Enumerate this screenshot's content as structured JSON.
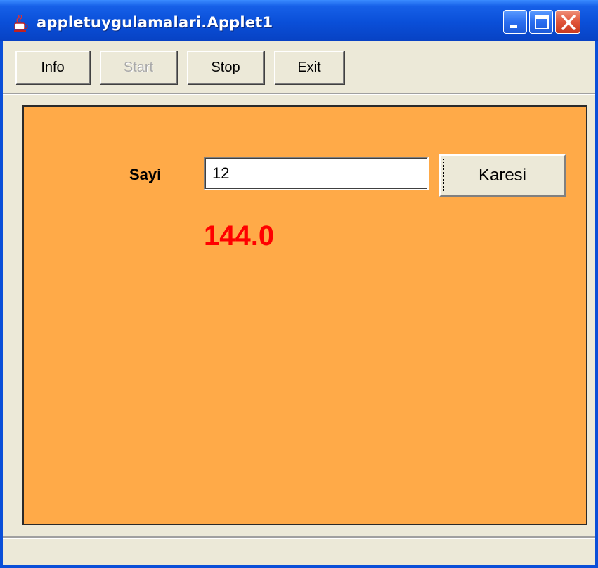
{
  "window": {
    "title": "appletuygulamalari.Applet1",
    "icon": "java-cup-icon",
    "controls": {
      "minimize": "minimize-icon",
      "maximize": "maximize-icon",
      "close": "close-icon"
    }
  },
  "toolbar": {
    "info_label": "Info",
    "start_label": "Start",
    "stop_label": "Stop",
    "exit_label": "Exit"
  },
  "applet": {
    "background_color": "#ffaa48",
    "sayi_label": "Sayi",
    "sayi_value": "12",
    "karesi_label": "Karesi",
    "result": "144.0",
    "result_color": "#ff0000"
  }
}
